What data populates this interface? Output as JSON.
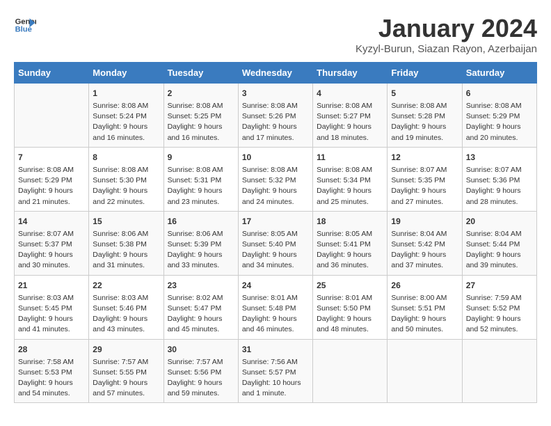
{
  "logo": {
    "line1": "General",
    "line2": "Blue"
  },
  "title": "January 2024",
  "location": "Kyzyl-Burun, Siazan Rayon, Azerbaijan",
  "days_of_week": [
    "Sunday",
    "Monday",
    "Tuesday",
    "Wednesday",
    "Thursday",
    "Friday",
    "Saturday"
  ],
  "weeks": [
    [
      {
        "day": "",
        "info": ""
      },
      {
        "day": "1",
        "info": "Sunrise: 8:08 AM\nSunset: 5:24 PM\nDaylight: 9 hours\nand 16 minutes."
      },
      {
        "day": "2",
        "info": "Sunrise: 8:08 AM\nSunset: 5:25 PM\nDaylight: 9 hours\nand 16 minutes."
      },
      {
        "day": "3",
        "info": "Sunrise: 8:08 AM\nSunset: 5:26 PM\nDaylight: 9 hours\nand 17 minutes."
      },
      {
        "day": "4",
        "info": "Sunrise: 8:08 AM\nSunset: 5:27 PM\nDaylight: 9 hours\nand 18 minutes."
      },
      {
        "day": "5",
        "info": "Sunrise: 8:08 AM\nSunset: 5:28 PM\nDaylight: 9 hours\nand 19 minutes."
      },
      {
        "day": "6",
        "info": "Sunrise: 8:08 AM\nSunset: 5:29 PM\nDaylight: 9 hours\nand 20 minutes."
      }
    ],
    [
      {
        "day": "7",
        "info": "Sunrise: 8:08 AM\nSunset: 5:29 PM\nDaylight: 9 hours\nand 21 minutes."
      },
      {
        "day": "8",
        "info": "Sunrise: 8:08 AM\nSunset: 5:30 PM\nDaylight: 9 hours\nand 22 minutes."
      },
      {
        "day": "9",
        "info": "Sunrise: 8:08 AM\nSunset: 5:31 PM\nDaylight: 9 hours\nand 23 minutes."
      },
      {
        "day": "10",
        "info": "Sunrise: 8:08 AM\nSunset: 5:32 PM\nDaylight: 9 hours\nand 24 minutes."
      },
      {
        "day": "11",
        "info": "Sunrise: 8:08 AM\nSunset: 5:34 PM\nDaylight: 9 hours\nand 25 minutes."
      },
      {
        "day": "12",
        "info": "Sunrise: 8:07 AM\nSunset: 5:35 PM\nDaylight: 9 hours\nand 27 minutes."
      },
      {
        "day": "13",
        "info": "Sunrise: 8:07 AM\nSunset: 5:36 PM\nDaylight: 9 hours\nand 28 minutes."
      }
    ],
    [
      {
        "day": "14",
        "info": "Sunrise: 8:07 AM\nSunset: 5:37 PM\nDaylight: 9 hours\nand 30 minutes."
      },
      {
        "day": "15",
        "info": "Sunrise: 8:06 AM\nSunset: 5:38 PM\nDaylight: 9 hours\nand 31 minutes."
      },
      {
        "day": "16",
        "info": "Sunrise: 8:06 AM\nSunset: 5:39 PM\nDaylight: 9 hours\nand 33 minutes."
      },
      {
        "day": "17",
        "info": "Sunrise: 8:05 AM\nSunset: 5:40 PM\nDaylight: 9 hours\nand 34 minutes."
      },
      {
        "day": "18",
        "info": "Sunrise: 8:05 AM\nSunset: 5:41 PM\nDaylight: 9 hours\nand 36 minutes."
      },
      {
        "day": "19",
        "info": "Sunrise: 8:04 AM\nSunset: 5:42 PM\nDaylight: 9 hours\nand 37 minutes."
      },
      {
        "day": "20",
        "info": "Sunrise: 8:04 AM\nSunset: 5:44 PM\nDaylight: 9 hours\nand 39 minutes."
      }
    ],
    [
      {
        "day": "21",
        "info": "Sunrise: 8:03 AM\nSunset: 5:45 PM\nDaylight: 9 hours\nand 41 minutes."
      },
      {
        "day": "22",
        "info": "Sunrise: 8:03 AM\nSunset: 5:46 PM\nDaylight: 9 hours\nand 43 minutes."
      },
      {
        "day": "23",
        "info": "Sunrise: 8:02 AM\nSunset: 5:47 PM\nDaylight: 9 hours\nand 45 minutes."
      },
      {
        "day": "24",
        "info": "Sunrise: 8:01 AM\nSunset: 5:48 PM\nDaylight: 9 hours\nand 46 minutes."
      },
      {
        "day": "25",
        "info": "Sunrise: 8:01 AM\nSunset: 5:50 PM\nDaylight: 9 hours\nand 48 minutes."
      },
      {
        "day": "26",
        "info": "Sunrise: 8:00 AM\nSunset: 5:51 PM\nDaylight: 9 hours\nand 50 minutes."
      },
      {
        "day": "27",
        "info": "Sunrise: 7:59 AM\nSunset: 5:52 PM\nDaylight: 9 hours\nand 52 minutes."
      }
    ],
    [
      {
        "day": "28",
        "info": "Sunrise: 7:58 AM\nSunset: 5:53 PM\nDaylight: 9 hours\nand 54 minutes."
      },
      {
        "day": "29",
        "info": "Sunrise: 7:57 AM\nSunset: 5:55 PM\nDaylight: 9 hours\nand 57 minutes."
      },
      {
        "day": "30",
        "info": "Sunrise: 7:57 AM\nSunset: 5:56 PM\nDaylight: 9 hours\nand 59 minutes."
      },
      {
        "day": "31",
        "info": "Sunrise: 7:56 AM\nSunset: 5:57 PM\nDaylight: 10 hours\nand 1 minute."
      },
      {
        "day": "",
        "info": ""
      },
      {
        "day": "",
        "info": ""
      },
      {
        "day": "",
        "info": ""
      }
    ]
  ]
}
